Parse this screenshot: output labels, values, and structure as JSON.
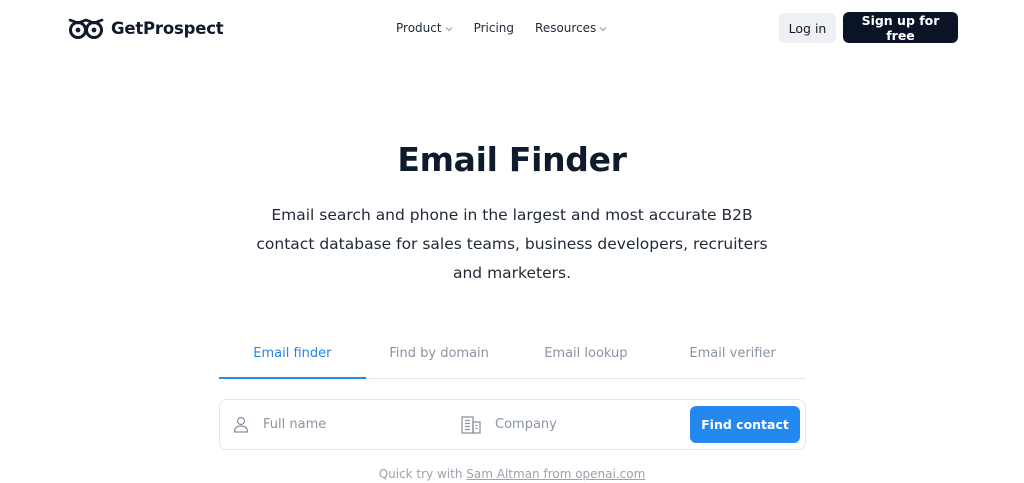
{
  "brand": {
    "name": "GetProspect",
    "logo_icon": "owl-eyes-icon"
  },
  "nav": {
    "items": [
      {
        "label": "Product",
        "has_dropdown": true
      },
      {
        "label": "Pricing",
        "has_dropdown": false
      },
      {
        "label": "Resources",
        "has_dropdown": true
      }
    ],
    "login_label": "Log in",
    "signup_label": "Sign up for free"
  },
  "hero": {
    "title": "Email Finder",
    "subtitle": "Email search and phone in the largest and most accurate B2B contact database for sales teams, business developers, recruiters and marketers."
  },
  "tabs": [
    {
      "label": "Email finder",
      "active": true
    },
    {
      "label": "Find by domain",
      "active": false
    },
    {
      "label": "Email lookup",
      "active": false
    },
    {
      "label": "Email verifier",
      "active": false
    }
  ],
  "search": {
    "name_placeholder": "Full name",
    "name_value": "",
    "name_icon": "user-icon",
    "company_placeholder": "Company",
    "company_value": "",
    "company_icon": "building-icon",
    "button_label": "Find contact"
  },
  "quick_try": {
    "prefix": "Quick try with",
    "link_label": "Sam Altman from openai.com"
  },
  "colors": {
    "accent": "#2388f0",
    "dark": "#0b1426",
    "muted": "#8a94a3",
    "login_bg": "#eef0f3"
  }
}
